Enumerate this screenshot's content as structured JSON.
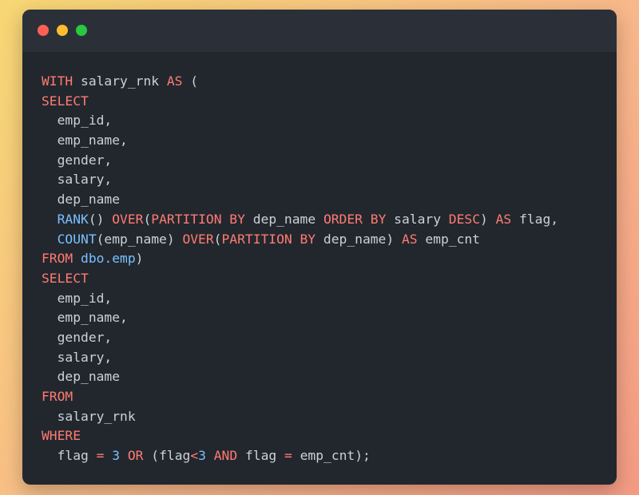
{
  "window": {
    "controls": [
      "close",
      "minimize",
      "maximize"
    ],
    "colors": {
      "close": "#fe5f57",
      "minimize": "#febc2e",
      "maximize": "#28c840",
      "background": "#22272e",
      "titlebar": "#2b3038"
    }
  },
  "code": {
    "language": "sql",
    "lines": [
      [
        {
          "t": "WITH",
          "c": "kw"
        },
        {
          "t": " salary_rnk ",
          "c": "id"
        },
        {
          "t": "AS",
          "c": "kw"
        },
        {
          "t": " (",
          "c": "id"
        }
      ],
      [
        {
          "t": "SELECT",
          "c": "kw"
        }
      ],
      [
        {
          "t": "  emp_id,",
          "c": "id"
        }
      ],
      [
        {
          "t": "  emp_name,",
          "c": "id"
        }
      ],
      [
        {
          "t": "  gender,",
          "c": "id"
        }
      ],
      [
        {
          "t": "  salary,",
          "c": "id"
        }
      ],
      [
        {
          "t": "  dep_name",
          "c": "id"
        }
      ],
      [
        {
          "t": "  ",
          "c": "id"
        },
        {
          "t": "RANK",
          "c": "fn"
        },
        {
          "t": "() ",
          "c": "id"
        },
        {
          "t": "OVER",
          "c": "kw"
        },
        {
          "t": "(",
          "c": "id"
        },
        {
          "t": "PARTITION BY",
          "c": "kw"
        },
        {
          "t": " dep_name ",
          "c": "id"
        },
        {
          "t": "ORDER BY",
          "c": "kw"
        },
        {
          "t": " salary ",
          "c": "id"
        },
        {
          "t": "DESC",
          "c": "kw"
        },
        {
          "t": ") ",
          "c": "id"
        },
        {
          "t": "AS",
          "c": "kw"
        },
        {
          "t": " flag,",
          "c": "id"
        }
      ],
      [
        {
          "t": "  ",
          "c": "id"
        },
        {
          "t": "COUNT",
          "c": "fn"
        },
        {
          "t": "(emp_name) ",
          "c": "id"
        },
        {
          "t": "OVER",
          "c": "kw"
        },
        {
          "t": "(",
          "c": "id"
        },
        {
          "t": "PARTITION BY",
          "c": "kw"
        },
        {
          "t": " dep_name) ",
          "c": "id"
        },
        {
          "t": "AS",
          "c": "kw"
        },
        {
          "t": " emp_cnt",
          "c": "id"
        }
      ],
      [
        {
          "t": "FROM",
          "c": "kw"
        },
        {
          "t": " ",
          "c": "id"
        },
        {
          "t": "dbo.emp",
          "c": "fn"
        },
        {
          "t": ")",
          "c": "id"
        }
      ],
      [
        {
          "t": "SELECT",
          "c": "kw"
        }
      ],
      [
        {
          "t": "  emp_id,",
          "c": "id"
        }
      ],
      [
        {
          "t": "  emp_name,",
          "c": "id"
        }
      ],
      [
        {
          "t": "  gender,",
          "c": "id"
        }
      ],
      [
        {
          "t": "  salary,",
          "c": "id"
        }
      ],
      [
        {
          "t": "  dep_name",
          "c": "id"
        }
      ],
      [
        {
          "t": "FROM",
          "c": "kw"
        }
      ],
      [
        {
          "t": "  salary_rnk",
          "c": "id"
        }
      ],
      [
        {
          "t": "WHERE",
          "c": "kw"
        }
      ],
      [
        {
          "t": "  flag ",
          "c": "id"
        },
        {
          "t": "=",
          "c": "op"
        },
        {
          "t": " ",
          "c": "id"
        },
        {
          "t": "3",
          "c": "num"
        },
        {
          "t": " ",
          "c": "id"
        },
        {
          "t": "OR",
          "c": "kw"
        },
        {
          "t": " (flag",
          "c": "id"
        },
        {
          "t": "<",
          "c": "op"
        },
        {
          "t": "3",
          "c": "num"
        },
        {
          "t": " ",
          "c": "id"
        },
        {
          "t": "AND",
          "c": "kw"
        },
        {
          "t": " flag ",
          "c": "id"
        },
        {
          "t": "=",
          "c": "op"
        },
        {
          "t": " emp_cnt);",
          "c": "id"
        }
      ]
    ]
  }
}
